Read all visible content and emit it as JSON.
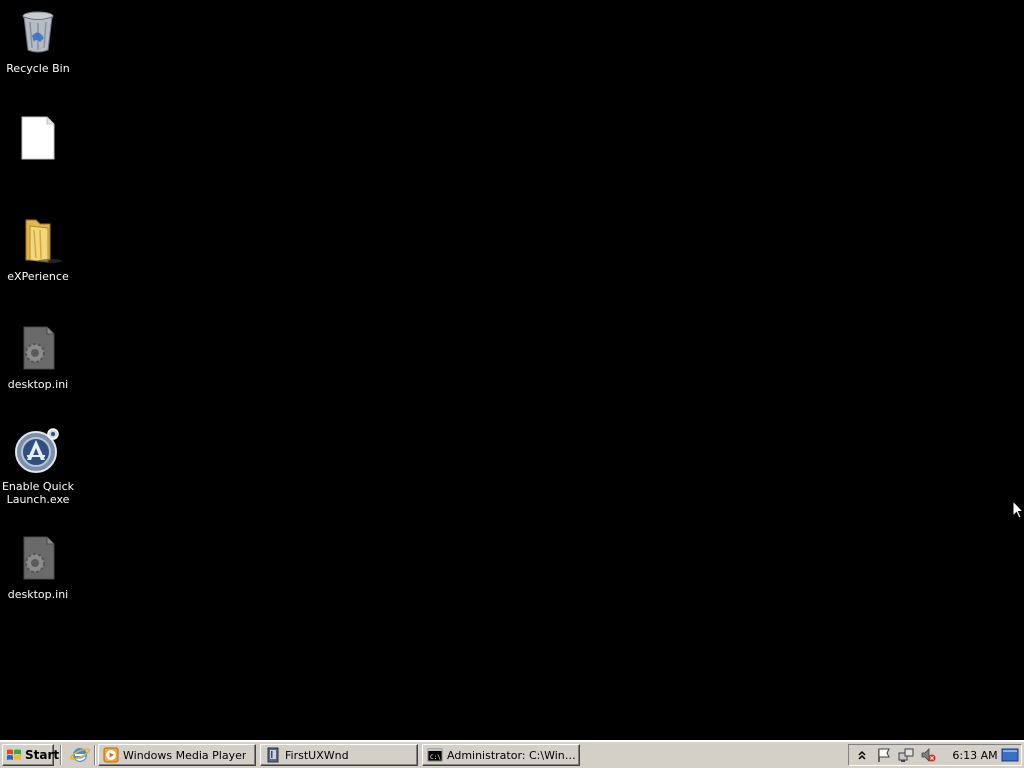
{
  "desktop": {
    "icons": [
      {
        "label": "Recycle Bin",
        "icon": "recycle-bin-icon"
      },
      {
        "label": "",
        "icon": "blank-file-icon"
      },
      {
        "label": "eXPerience",
        "icon": "folder-icon"
      },
      {
        "label": "desktop.ini",
        "icon": "settings-file-icon"
      },
      {
        "label": "Enable Quick Launch.exe",
        "icon": "quick-launch-app-icon"
      },
      {
        "label": "desktop.ini",
        "icon": "settings-file-icon"
      }
    ]
  },
  "taskbar": {
    "start_label": "Start",
    "quick_launch": [
      {
        "icon": "internet-explorer-icon"
      }
    ],
    "tasks": [
      {
        "label": "Windows Media Player",
        "icon": "media-player-icon"
      },
      {
        "label": "FirstUXWnd",
        "icon": "window-app-icon"
      },
      {
        "label": "Administrator: C:\\Windo...",
        "icon": "command-prompt-icon"
      }
    ],
    "tray": {
      "icons": [
        "chevron-up-icon",
        "flag-icon",
        "network-icon",
        "volume-muted-icon"
      ],
      "clock": "6:13 AM"
    },
    "show_desktop_icon": "show-desktop-icon"
  },
  "colors": {
    "desktop_background": "#000000",
    "taskbar": "#d4d0c8"
  }
}
